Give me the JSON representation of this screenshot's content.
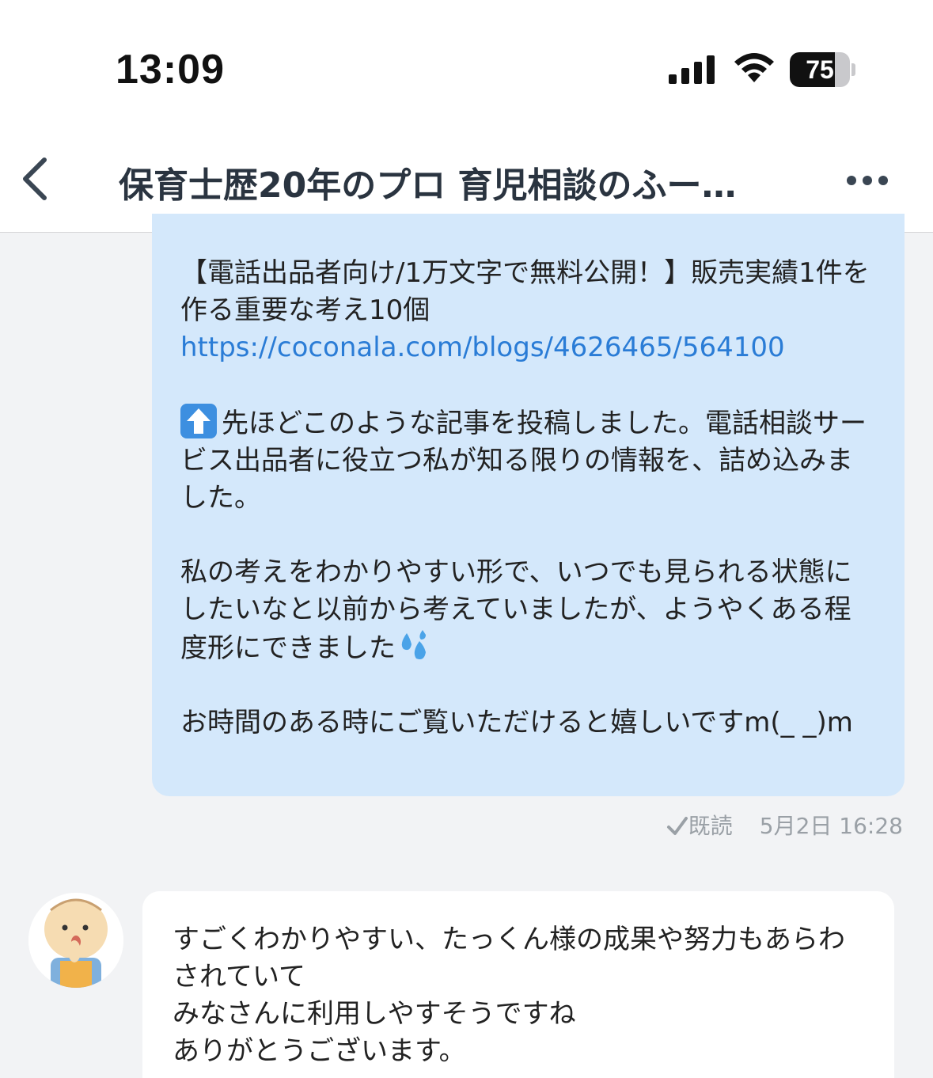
{
  "status_bar": {
    "time": "13:09",
    "battery_percent": 75,
    "battery_label": "75",
    "icons": [
      "signal-icon",
      "wifi-icon",
      "battery-icon"
    ]
  },
  "header": {
    "title": "保育士歴20年のプロ 育児相談のふー…",
    "back_icon": "chevron-left-icon",
    "more_icon": "ellipsis-icon"
  },
  "messages": {
    "sent": {
      "line1": "【電話出品者向け/1万文字で無料公開！】販売実績1件を作る重要な考え10個",
      "link": "https://coconala.com/blogs/4626465/564100",
      "para2": "先ほどこのような記事を投稿しました。電話相談サービス出品者に役立つ私が知る限りの情報を、詰め込みました。",
      "para3": "私の考えをわかりやすい形で、いつでも見られる状態にしたいなと以前から考えていましたが、ようやくある程度形にできました",
      "para4": "お時間のある時にご覧いただけると嬉しいですm(_ _)m",
      "read_label": "既読",
      "timestamp": "5月2日 16:28"
    },
    "received": {
      "line1": "すごくわかりやすい、たっくん様の成果や努力もあらわされていて",
      "line2": "みなさんに利用しやすそうですね",
      "line3": "ありがとうございます。"
    }
  },
  "colors": {
    "sent_bubble": "#d4e8fb",
    "received_bubble": "#ffffff",
    "link": "#2a7cd6",
    "background": "#f2f3f5"
  }
}
